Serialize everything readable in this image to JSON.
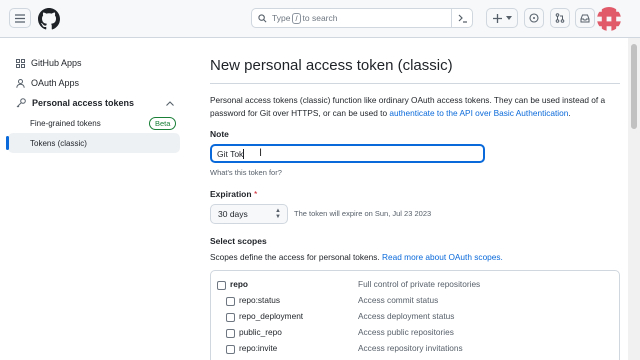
{
  "header": {
    "search": {
      "prefix": "Type",
      "key": "/",
      "suffix": "to search"
    }
  },
  "sidebar": {
    "items": [
      {
        "label": "GitHub Apps",
        "icon": "apps-grid-icon"
      },
      {
        "label": "OAuth Apps",
        "icon": "person-icon"
      },
      {
        "label": "Personal access tokens",
        "icon": "key-icon"
      }
    ],
    "sub_items": [
      {
        "label": "Fine-grained tokens",
        "badge": "Beta"
      },
      {
        "label": "Tokens (classic)"
      }
    ]
  },
  "main": {
    "title": "New personal access token (classic)",
    "description_prefix": "Personal access tokens (classic) function like ordinary OAuth access tokens. They can be used instead of a password for Git over HTTPS, or can be used to ",
    "description_link": "authenticate to the API over Basic Authentication",
    "description_suffix": ".",
    "note_label": "Note",
    "note_value": "Git Tok",
    "note_help": "What's this token for?",
    "expiration_label": "Expiration",
    "expiration_required": "*",
    "expiration_value": "30 days",
    "expiration_note": "The token will expire on Sun, Jul 23 2023",
    "scopes_label": "Select scopes",
    "scopes_desc_prefix": "Scopes define the access for personal tokens. ",
    "scopes_desc_link": "Read more about OAuth scopes.",
    "scopes": [
      {
        "name": "repo",
        "desc": "Full control of private repositories"
      },
      {
        "name": "repo:status",
        "desc": "Access commit status"
      },
      {
        "name": "repo_deployment",
        "desc": "Access deployment status"
      },
      {
        "name": "public_repo",
        "desc": "Access public repositories"
      },
      {
        "name": "repo:invite",
        "desc": "Access repository invitations"
      }
    ]
  },
  "colors": {
    "link": "#0969da",
    "success": "#1a7f37",
    "danger": "#cf222e",
    "focus": "#0969da"
  }
}
